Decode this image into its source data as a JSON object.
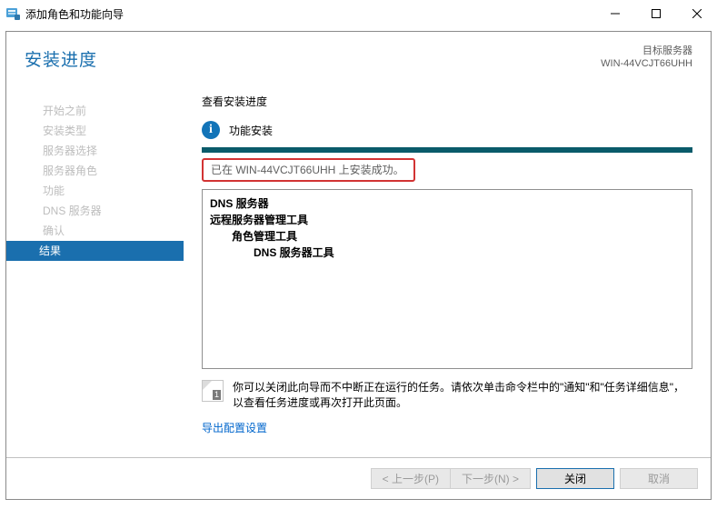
{
  "window": {
    "title": "添加角色和功能向导"
  },
  "header": {
    "page_title": "安装进度",
    "target_label": "目标服务器",
    "target_server": "WIN-44VCJT66UHH"
  },
  "sidebar": {
    "steps": [
      "开始之前",
      "安装类型",
      "服务器选择",
      "服务器角色",
      "功能",
      "DNS 服务器",
      "确认",
      "结果"
    ],
    "active_index": 7
  },
  "content": {
    "view_label": "查看安装进度",
    "status_text": "功能安装",
    "success_text": "已在 WIN-44VCJT66UHH 上安装成功。",
    "results": [
      {
        "text": "DNS 服务器",
        "indent": 0,
        "bold": true
      },
      {
        "text": "远程服务器管理工具",
        "indent": 0,
        "bold": true
      },
      {
        "text": "角色管理工具",
        "indent": 1,
        "bold": true
      },
      {
        "text": "DNS 服务器工具",
        "indent": 2,
        "bold": true
      }
    ],
    "note_text": "你可以关闭此向导而不中断正在运行的任务。请依次单击命令栏中的\"通知\"和\"任务详细信息\"，以查看任务进度或再次打开此页面。",
    "export_link": "导出配置设置"
  },
  "footer": {
    "prev": "< 上一步(P)",
    "next": "下一步(N) >",
    "close": "关闭",
    "cancel": "取消"
  }
}
